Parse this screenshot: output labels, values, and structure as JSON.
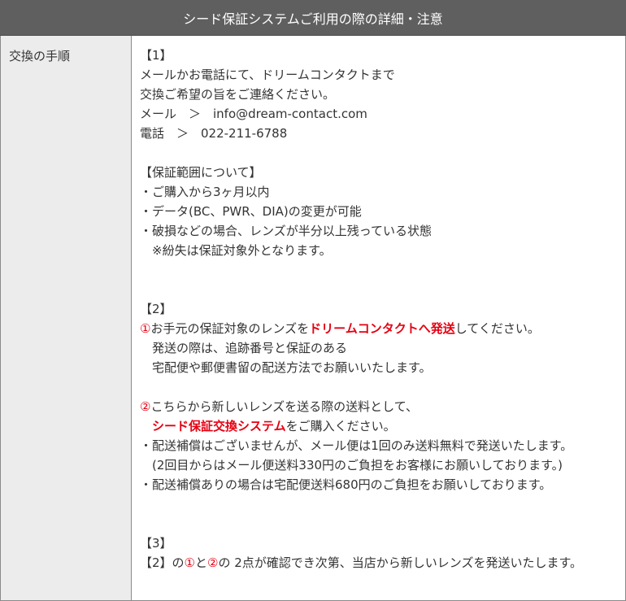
{
  "header": {
    "title": "シード保証システムご利用の際の詳細・注意"
  },
  "left": {
    "label": "交換の手順"
  },
  "step1": {
    "heading": "【1】",
    "line1": "メールかお電話にて、ドリームコンタクトまで",
    "line2": "交換ご希望の旨をご連絡ください。",
    "mail": "メール　＞　info@dream-contact.com",
    "phone": "電話　＞　022-211-6788"
  },
  "coverage": {
    "heading": "【保証範囲について】",
    "item1": "・ご購入から3ヶ月以内",
    "item2": "・データ(BC、PWR、DIA)の変更が可能",
    "item3": "・破損などの場合、レンズが半分以上残っている状態",
    "note": "　※紛失は保証対象外となります。"
  },
  "step2": {
    "heading": "【2】",
    "circle1": "①",
    "l1_pre": "お手元の保証対象のレンズを",
    "l1_red": "ドリームコンタクトへ発送",
    "l1_post": "してください。",
    "l2": "　発送の際は、追跡番号と保証のある",
    "l3": "　宅配便や郵便書留の配送方法でお願いいたします。",
    "circle2": "②",
    "l4": "こちらから新しいレンズを送る際の送料として、",
    "l5_indent": "　",
    "l5_red": "シード保証交換システム",
    "l5_post": "をご購入ください。",
    "l6": "・配送補償はございませんが、メール便は1回のみ送料無料で発送いたします。",
    "l7": "　(2回目からはメール便送料330円のご負担をお客様にお願いしております。)",
    "l8": "・配送補償ありの場合は宅配便送料680円のご負担をお願いしております。"
  },
  "step3": {
    "heading": "【3】",
    "pre": "【2】の",
    "c1": "①",
    "mid": "と",
    "c2": "②",
    "post": "の 2点が確認でき次第、当店から新しいレンズを発送いたします。"
  },
  "colors": {
    "header_bg": "#5f5f5f",
    "left_bg": "#ececec",
    "accent_red": "#e60012"
  }
}
